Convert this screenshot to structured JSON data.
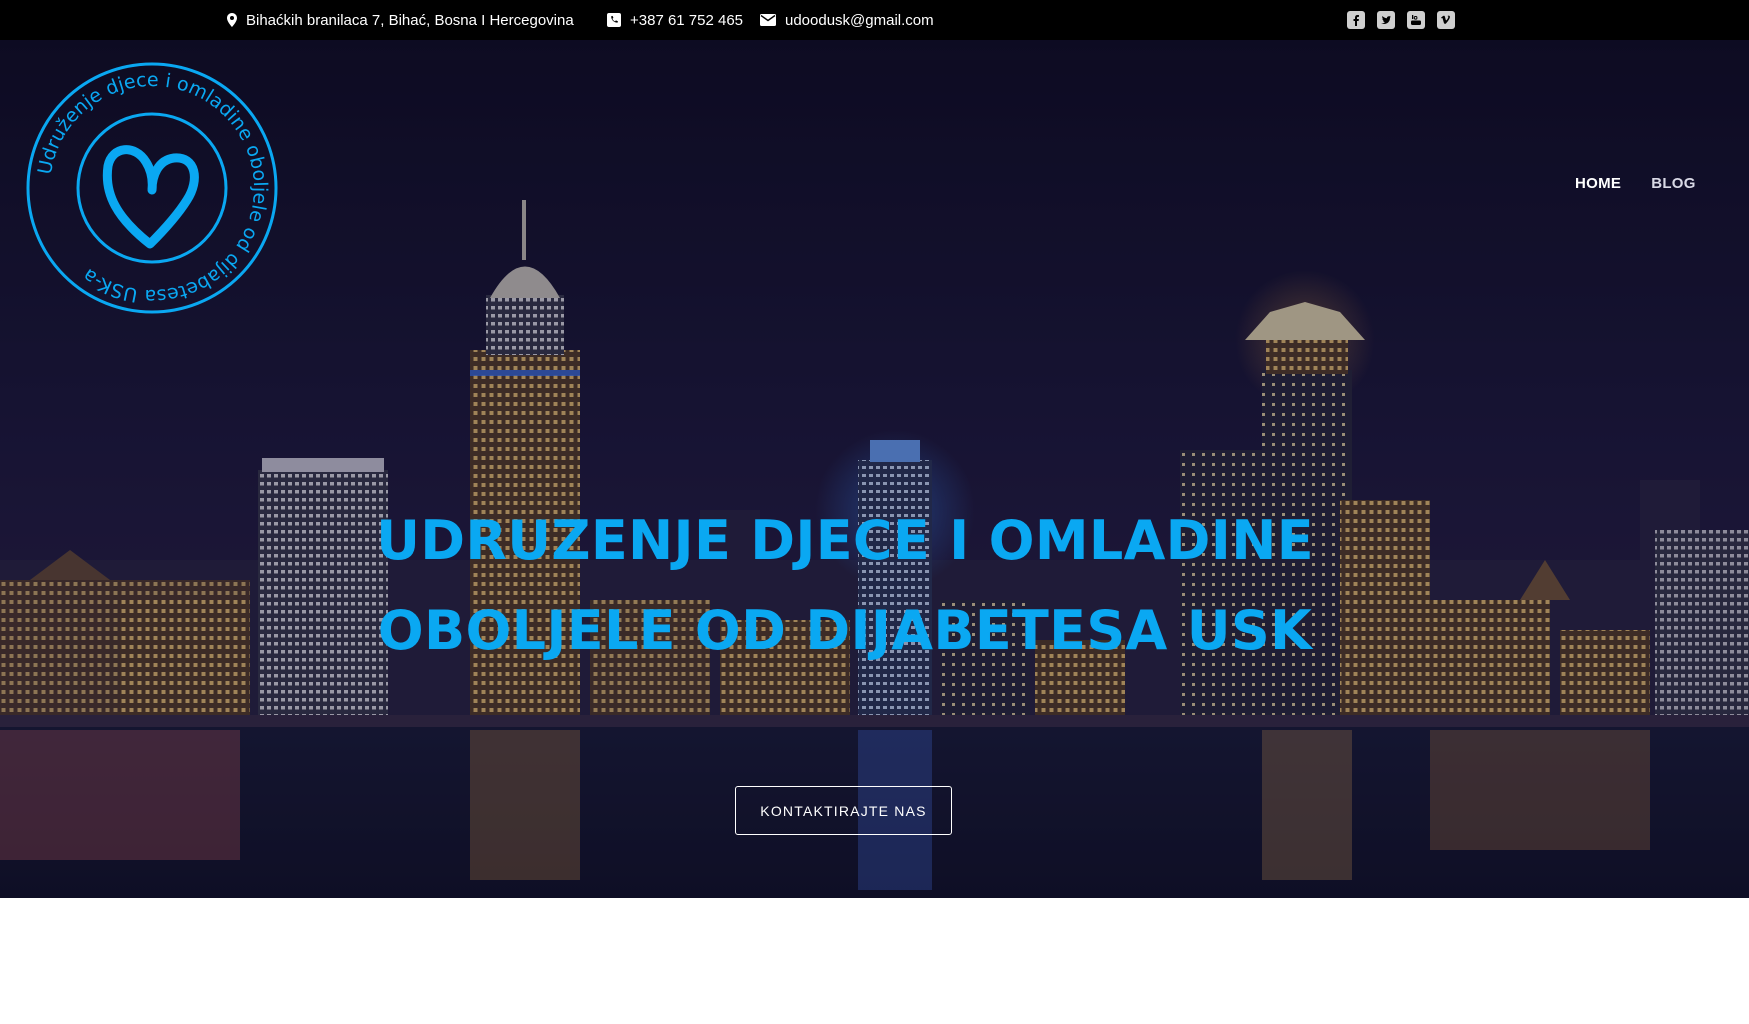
{
  "topbar": {
    "address": "Bihaćkih branilaca 7, Bihać, Bosna I Hercegovina",
    "phone": "+387 61 752 465",
    "email": "udoodusk@gmail.com",
    "address_icon": "map-marker-icon",
    "phone_icon": "phone-icon",
    "email_icon": "envelope-icon",
    "social": [
      "facebook-icon",
      "twitter-icon",
      "youtube-icon",
      "vimeo-icon"
    ]
  },
  "logo": {
    "ring_text": "Udruženje djece i omladine oboljele od dijabetesa USK-a",
    "icon": "heart-icon",
    "color": "#0aa8f2"
  },
  "nav": {
    "items": [
      {
        "label": "HOME",
        "active": true
      },
      {
        "label": "BLOG",
        "active": false
      }
    ]
  },
  "hero": {
    "title_line1": "UDRUZENJE DJECE I OMLADINE",
    "title_line2": "OBOLJELE OD DIJABETESA USK",
    "cta_label": "KONTAKTIRAJTE NAS",
    "background": "night-city-skyline-image",
    "accent_color": "#0aa8f2"
  }
}
